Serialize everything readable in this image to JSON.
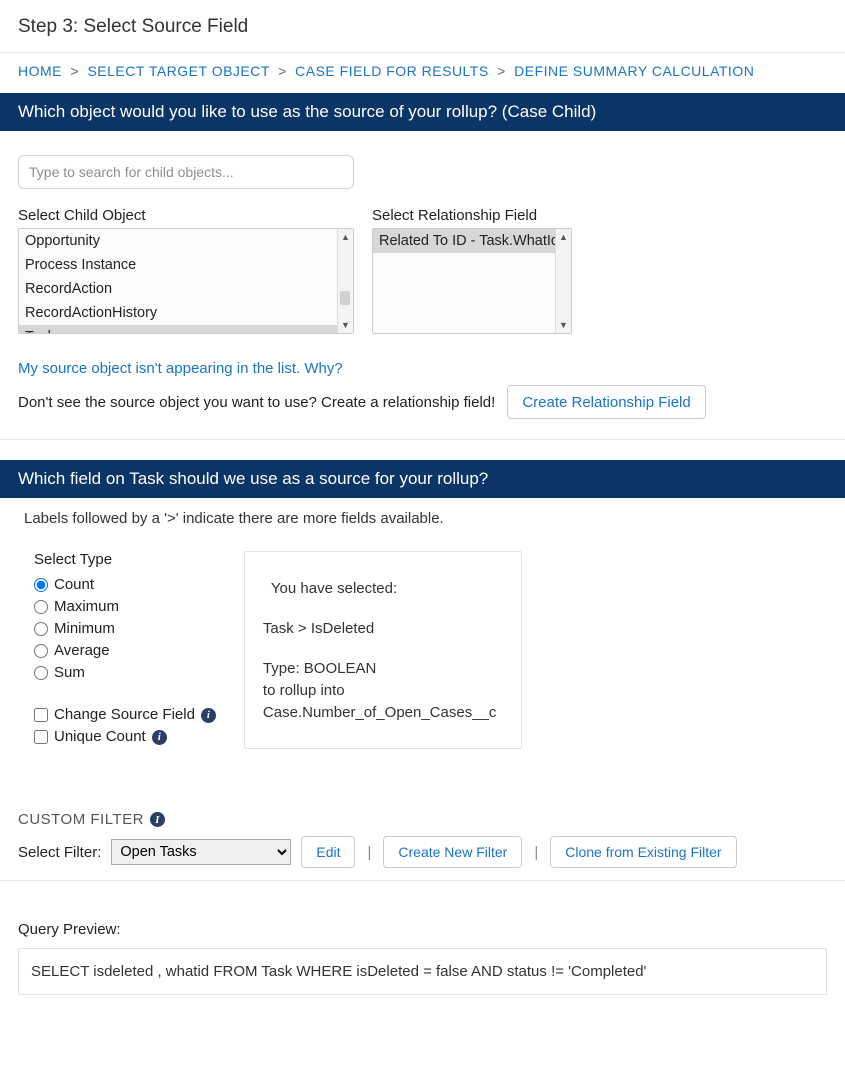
{
  "step_title": "Step 3: Select Source Field",
  "breadcrumbs": {
    "home": "HOME",
    "target": "SELECT TARGET OBJECT",
    "casefield": "CASE FIELD FOR RESULTS",
    "define": "DEFINE SUMMARY CALCULATION",
    "sep": ">"
  },
  "band1": "Which object would you like to use as the source of your rollup? (Case Child)",
  "search": {
    "placeholder": "Type to search for child objects..."
  },
  "child_label": "Select Child Object",
  "child_items": {
    "i0": "Opportunity",
    "i1": "Process Instance",
    "i2": "RecordAction",
    "i3": "RecordActionHistory",
    "i4": "Task"
  },
  "rel_label": "Select Relationship Field",
  "rel_items": {
    "i0": "Related To ID - Task.WhatId"
  },
  "help_link": "My source object isn't appearing in the list. Why?",
  "help_text": "Don't see the source object you want to use? Create a relationship field!",
  "create_btn": "Create Relationship Field",
  "band2": "Which field on Task should we use as a source for your rollup?",
  "note": "Labels followed by a '>' indicate there are more fields available.",
  "type_hdr": "Select Type",
  "types": {
    "count": "Count",
    "max": "Maximum",
    "min": "Minimum",
    "avg": "Average",
    "sum": "Sum"
  },
  "change_src": "Change Source Field",
  "unique": "Unique Count",
  "selbox": {
    "l1": "You have selected:",
    "l2": "Task > IsDeleted",
    "l3": "Type: BOOLEAN",
    "l4": "to rollup into",
    "l5": "Case.Number_of_Open_Cases__c"
  },
  "cf_head": "CUSTOM FILTER",
  "cf_label": "Select Filter:",
  "cf_selected": "Open Tasks",
  "cf_edit": "Edit",
  "cf_new": "Create New Filter",
  "cf_clone": "Clone from Existing Filter",
  "q_head": "Query Preview:",
  "q_text": "SELECT isdeleted , whatid FROM Task WHERE isDeleted = false AND status != 'Completed'"
}
